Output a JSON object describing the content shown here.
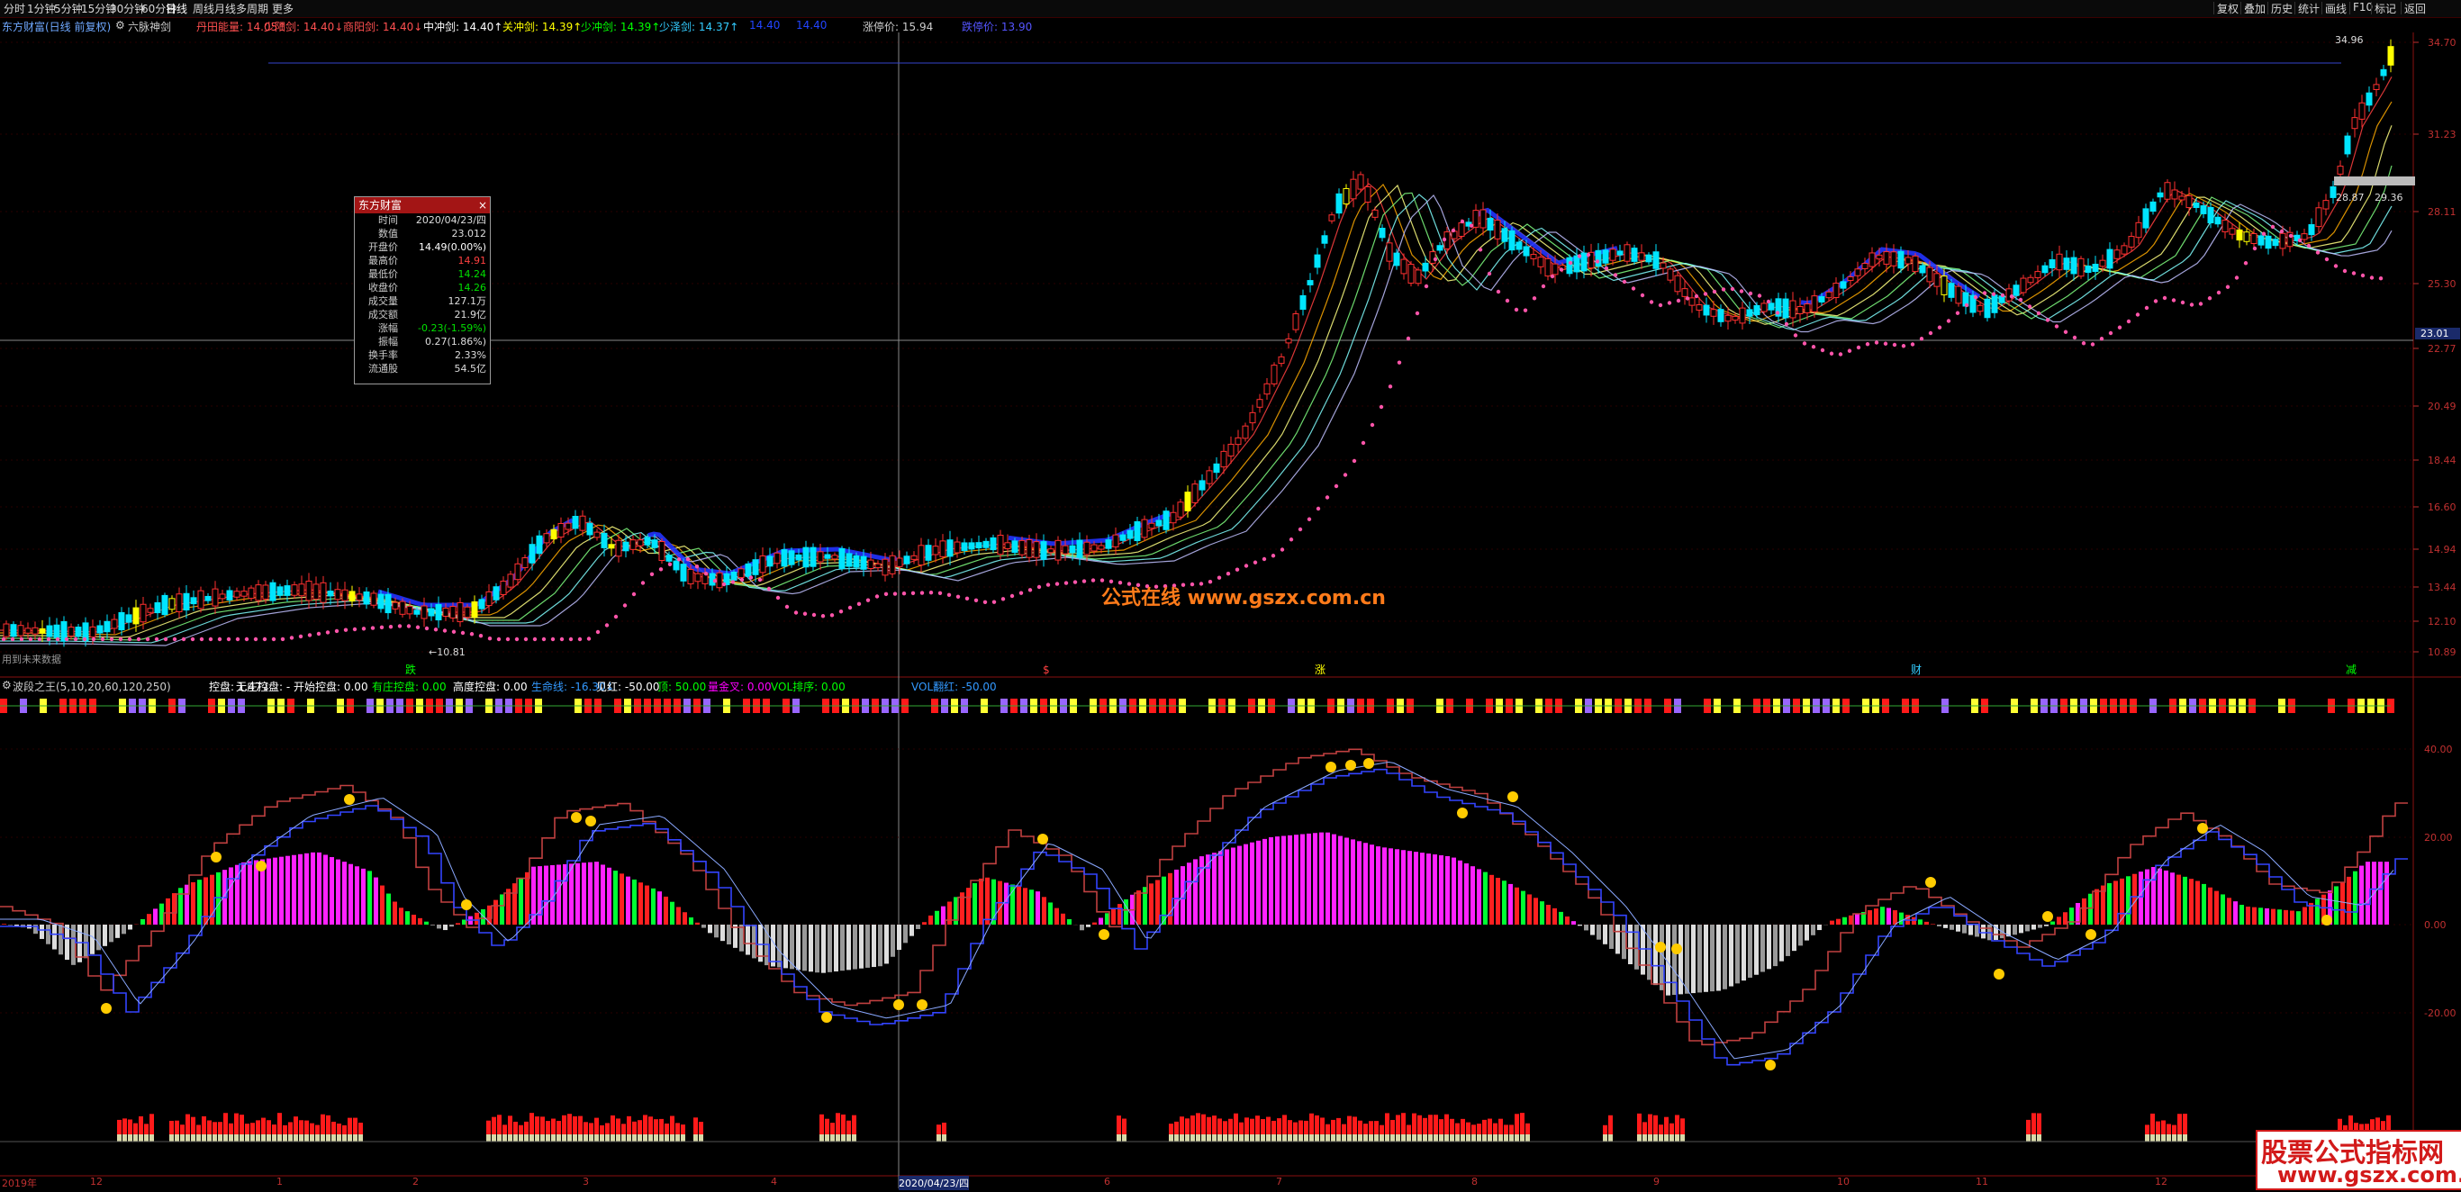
{
  "toolbar": {
    "left_items": [
      "分时",
      "1分钟",
      "5分钟",
      "15分钟",
      "30分钟",
      "60分钟",
      "日线",
      "周线",
      "月线",
      "多周期",
      "更多"
    ],
    "right_items": [
      "复权",
      "叠加",
      "历史",
      "统计",
      "画线",
      "F10",
      "标记",
      "返回"
    ]
  },
  "top_legend": {
    "title": "东方财富(日线 前复权)",
    "indicator": "六脉神剑",
    "items": [
      {
        "text": "丹田能量: 14.05↑",
        "color": "#ff5050"
      },
      {
        "text": "少阳剑: 14.40↓",
        "color": "#ff5050"
      },
      {
        "text": "商阳剑: 14.40↓",
        "color": "#ff5050"
      },
      {
        "text": "中冲剑: 14.40↑",
        "color": "#ffffff"
      },
      {
        "text": "关冲剑: 14.39↑",
        "color": "#ffff00"
      },
      {
        "text": "少冲剑: 14.39↑",
        "color": "#00ff00"
      },
      {
        "text": "少泽剑: 14.37↑",
        "color": "#33ccff"
      },
      {
        "text": "14.40",
        "color": "#2244ff"
      },
      {
        "text": "14.40",
        "color": "#2244ff"
      },
      {
        "text": "涨停价: 15.94",
        "color": "#cccccc"
      },
      {
        "text": "跌停价: 13.90",
        "color": "#5555ff"
      }
    ]
  },
  "info_box": {
    "title": "东方财富",
    "rows": [
      {
        "k": "时间",
        "v": "2020/04/23/四",
        "c": "#dddddd"
      },
      {
        "k": "数值",
        "v": "23.012",
        "c": "#dddddd"
      },
      {
        "k": "开盘价",
        "v": "14.49(0.00%)",
        "c": "#ffffff"
      },
      {
        "k": "最高价",
        "v": "14.91",
        "c": "#ff4040"
      },
      {
        "k": "最低价",
        "v": "14.24",
        "c": "#00e000"
      },
      {
        "k": "收盘价",
        "v": "14.26",
        "c": "#00e000"
      },
      {
        "k": "成交量",
        "v": "127.1万",
        "c": "#dddddd"
      },
      {
        "k": "成交额",
        "v": "21.9亿",
        "c": "#dddddd"
      },
      {
        "k": "涨幅",
        "v": "-0.23(-1.59%)",
        "c": "#00e000"
      },
      {
        "k": "振幅",
        "v": "0.27(1.86%)",
        "c": "#dddddd"
      },
      {
        "k": "换手率",
        "v": "2.33%",
        "c": "#dddddd"
      },
      {
        "k": "流通股",
        "v": "54.5亿",
        "c": "#dddddd"
      }
    ]
  },
  "price_axis": {
    "labels": [
      "34.70",
      "31.23",
      "28.11",
      "25.30",
      "22.77",
      "20.49",
      "18.44",
      "16.60",
      "14.94",
      "13.44",
      "12.10",
      "10.89"
    ],
    "current": "23.01"
  },
  "chart_annotations": {
    "high_label": "34.96",
    "low_label": "10.81",
    "future_label": "用到未来数据",
    "right_labels": [
      "28.87",
      "29.36"
    ],
    "markers": [
      "跌",
      "涨",
      "财",
      "减"
    ]
  },
  "watermark": "公式在线  www.gszx.com.cn",
  "lower_legend": {
    "indicator": "波段之王(5,10,20,60,120,250)",
    "items": [
      {
        "text": "控盘: 1.47↓",
        "color": "#ffffff"
      },
      {
        "text": "无庄控盘: - 开始控盘: 0.00",
        "color": "#ffffff"
      },
      {
        "text": "有庄控盘: 0.00",
        "color": "#00ff00"
      },
      {
        "text": "高度控盘: 0.00",
        "color": "#ffffff"
      },
      {
        "text": "生命线: -16.30↓",
        "color": "#3399ff"
      },
      {
        "text": "见红: -50.00",
        "color": "#ffffff"
      },
      {
        "text": "顶: 50.00",
        "color": "#00ff00"
      },
      {
        "text": "量金叉: 0.00",
        "color": "#ff00ff"
      },
      {
        "text": "VOL排序: 0.00",
        "color": "#00ff00"
      },
      {
        "text": "VOL翻红: -50.00",
        "color": "#3399ff"
      }
    ]
  },
  "lower_axis": {
    "labels": [
      "40.00",
      "20.00",
      "0.00",
      "-20.00"
    ]
  },
  "date_axis": {
    "year": "2019年",
    "labels": [
      "12",
      "1",
      "2",
      "3",
      "4",
      "5",
      "6",
      "7",
      "8",
      "9",
      "10",
      "11",
      "12"
    ],
    "cursor_date": "2020/04/23/四"
  },
  "brand": {
    "line1": "股票公式指标网",
    "line2": "www.gszx.com.cn"
  },
  "colors": {
    "bg": "#000000",
    "up": "#ff3030",
    "down": "#00ffff",
    "grid": "#3a0000",
    "accent": "#d21a1a"
  }
}
